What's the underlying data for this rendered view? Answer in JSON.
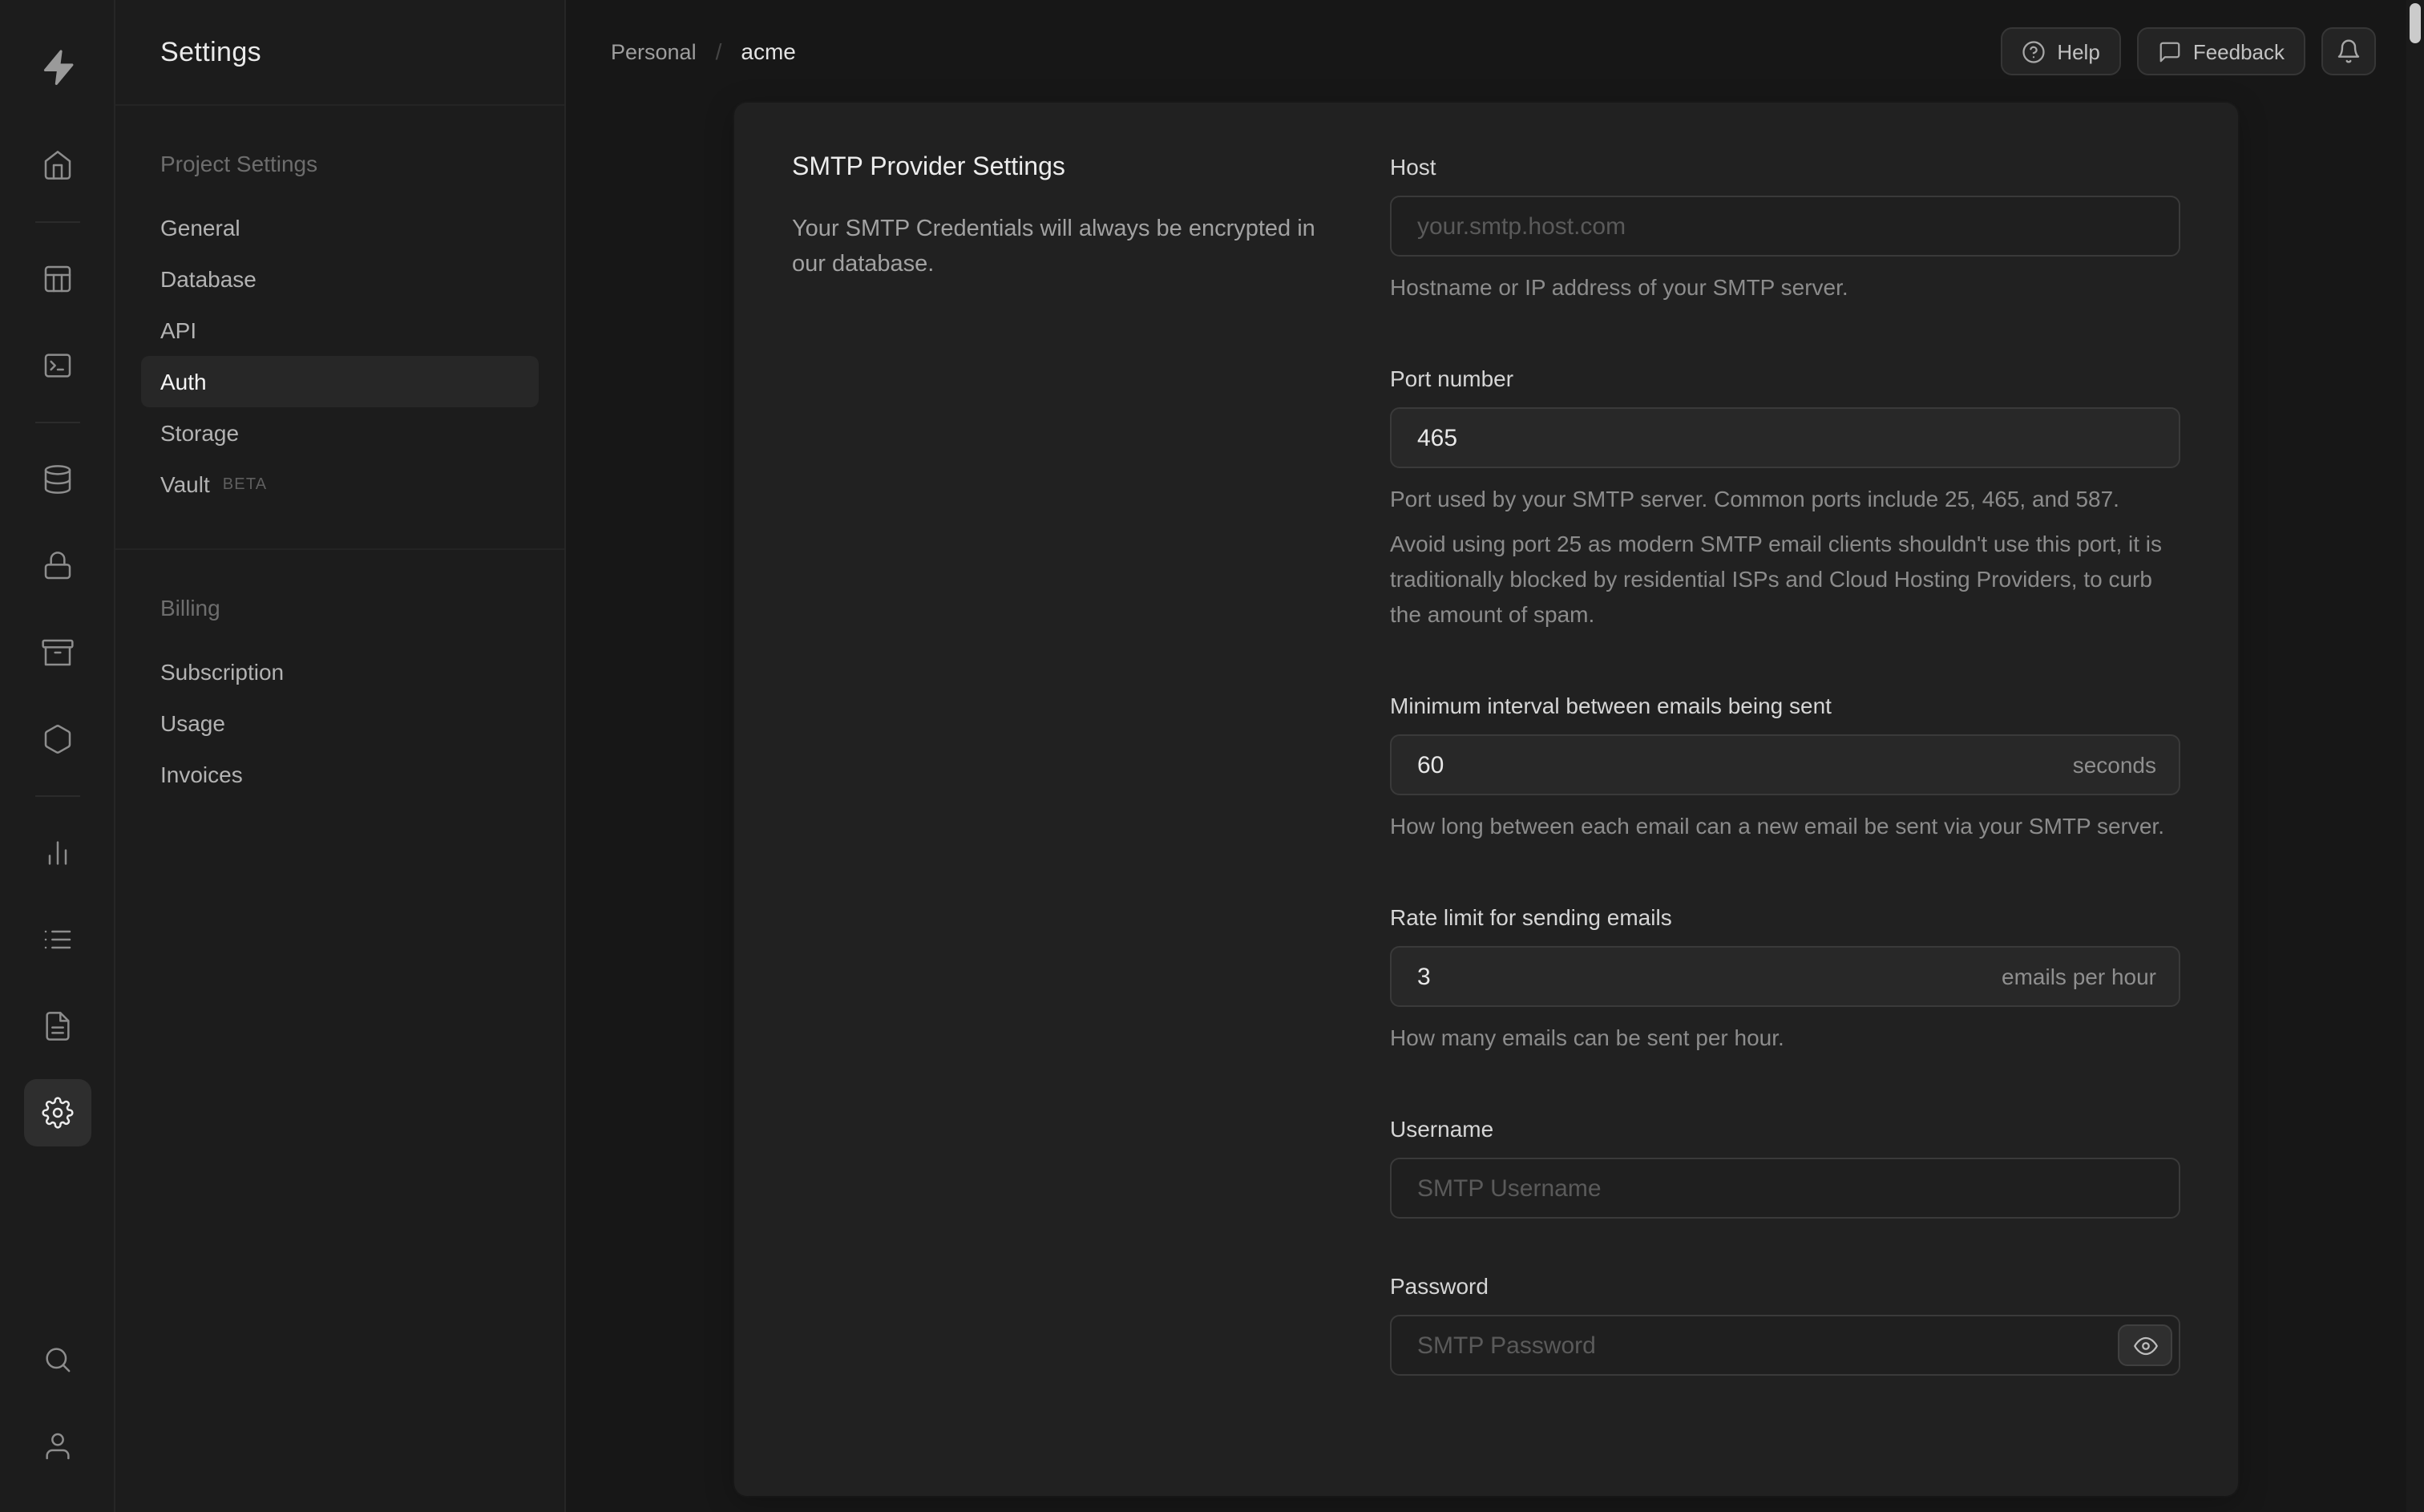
{
  "brand": {
    "name": "Supabase",
    "logo_icon": "lightning-bolt"
  },
  "header": {
    "breadcrumb": {
      "org": "Personal",
      "separator": "/",
      "project": "acme"
    },
    "help_button": "Help",
    "feedback_button": "Feedback",
    "icons": [
      "help-circle-icon",
      "message-icon",
      "bell-icon"
    ]
  },
  "rail": {
    "icons": [
      "home",
      "table-editor",
      "sql-editor",
      "database",
      "auth",
      "storage",
      "edge-functions",
      "reports",
      "logs",
      "docs",
      "settings",
      "search",
      "account"
    ],
    "active": "settings"
  },
  "sidebar": {
    "title": "Settings",
    "sections": [
      {
        "heading": "Project Settings",
        "items": [
          {
            "label": "General"
          },
          {
            "label": "Database"
          },
          {
            "label": "API"
          },
          {
            "label": "Auth",
            "active": true
          },
          {
            "label": "Storage"
          },
          {
            "label": "Vault",
            "badge": "BETA"
          }
        ]
      },
      {
        "heading": "Billing",
        "items": [
          {
            "label": "Subscription"
          },
          {
            "label": "Usage"
          },
          {
            "label": "Invoices"
          }
        ]
      }
    ]
  },
  "panel": {
    "title": "SMTP Provider Settings",
    "description": "Your SMTP Credentials will always be encrypted in our database.",
    "fields": {
      "host": {
        "label": "Host",
        "placeholder": "your.smtp.host.com",
        "help": "Hostname or IP address of your SMTP server."
      },
      "port": {
        "label": "Port number",
        "value": "465",
        "help": "Port used by your SMTP server. Common ports include 25, 465, and 587.",
        "help2": "Avoid using port 25 as modern SMTP email clients shouldn't use this port, it is traditionally blocked by residential ISPs and Cloud Hosting Providers, to curb the amount of spam."
      },
      "interval": {
        "label": "Minimum interval between emails being sent",
        "value": "60",
        "suffix": "seconds",
        "help": "How long between each email can a new email be sent via your SMTP server."
      },
      "rate": {
        "label": "Rate limit for sending emails",
        "value": "3",
        "suffix": "emails per hour",
        "help": "How many emails can be sent per hour."
      },
      "username": {
        "label": "Username",
        "placeholder": "SMTP Username"
      },
      "password": {
        "label": "Password",
        "placeholder": "SMTP Password"
      }
    }
  },
  "colors": {
    "page_bg": "#171717",
    "sidebar_bg": "#1c1c1c",
    "panel_bg": "#212121"
  }
}
